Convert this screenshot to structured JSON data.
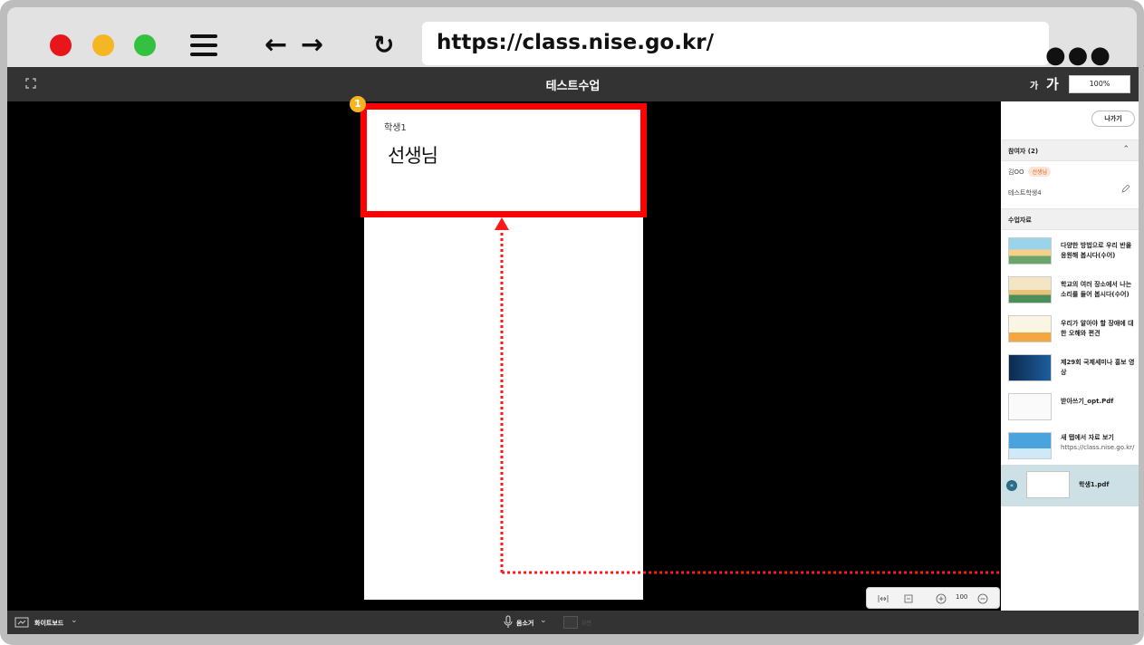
{
  "browser": {
    "url": "https://class.nise.go.kr/",
    "traffic_lights": {
      "close_color": "#e8161b",
      "minimize_color": "#f5b623",
      "maximize_color": "#34c040"
    },
    "more_label": "●●●"
  },
  "app": {
    "title": "테스트수업",
    "font_small_label": "가",
    "font_large_label": "가",
    "zoom_value": "100%"
  },
  "stage": {
    "student_label": "학생1",
    "handwriting": "선생님",
    "callout_number": "1",
    "highlight_color": "#ff0000",
    "callout_color": "#f3b522"
  },
  "sidebar": {
    "exit_label": "나가기",
    "participants_header": "참여자 (2)",
    "participants": [
      {
        "name": "김OO",
        "tag": "선생님"
      },
      {
        "name": "테스트학생4",
        "tag": ""
      }
    ],
    "materials_header": "수업자료",
    "materials": [
      {
        "label": "다양한 방법으로 우리 반을 응원해 봅시다(수어)",
        "sub": ""
      },
      {
        "label": "학교의 여러 장소에서 나는 소리를 들어 봅시다(수어)",
        "sub": ""
      },
      {
        "label": "우리가 알아야 할 장애에 대한 오해와 편견",
        "sub": ""
      },
      {
        "label": "제29회 국제세미나 홍보 영상",
        "sub": ""
      },
      {
        "label": "받아쓰기_opt.Pdf",
        "sub": ""
      },
      {
        "label": "새 탭에서 자료 보기",
        "sub": "https://class.nise.go.kr/"
      }
    ],
    "selected_material": "학생1.pdf",
    "selected_color": "#cde0e6"
  },
  "toolbox": {
    "zoom_value": "100"
  },
  "bottombar": {
    "whiteboard_label": "화이트보드",
    "mic_label": "음소거",
    "screen_label": "화면"
  }
}
